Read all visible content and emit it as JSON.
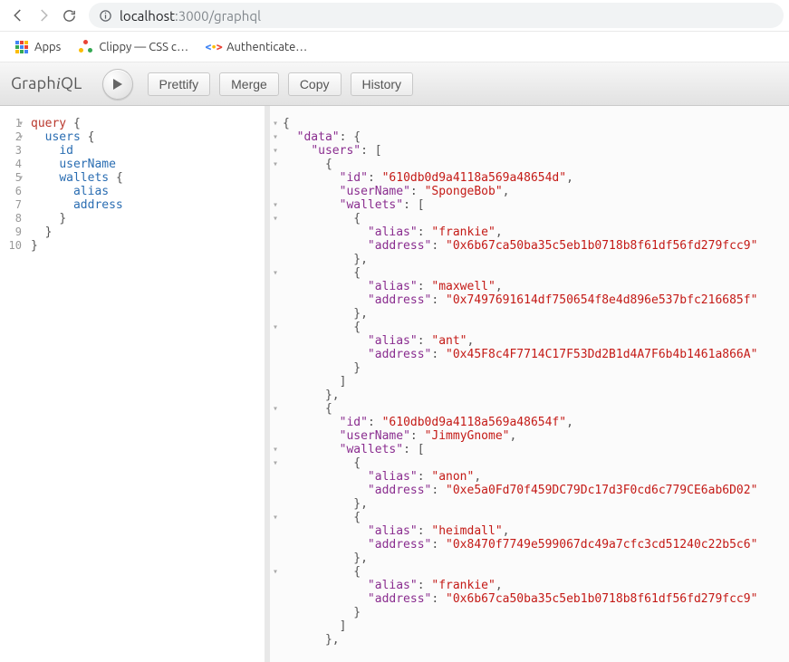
{
  "browser": {
    "url_host": "localhost",
    "url_port_path": ":3000/graphql"
  },
  "bookmarks": {
    "apps": "Apps",
    "clippy": "Clippy — CSS c…",
    "authenticate": "Authenticate…"
  },
  "toolbar": {
    "logo_graph": "Graph",
    "logo_i": "i",
    "logo_ql": "QL",
    "prettify": "Prettify",
    "merge": "Merge",
    "copy": "Copy",
    "history": "History"
  },
  "query": {
    "lines": [
      "1",
      "2",
      "3",
      "4",
      "5",
      "6",
      "7",
      "8",
      "9",
      "10"
    ],
    "text": "query {\n  users {\n    id\n    userName\n    wallets {\n      alias\n      address\n    }\n  }\n}"
  },
  "result": {
    "data": {
      "users": [
        {
          "id": "610db0d9a4118a569a48654d",
          "userName": "SpongeBob",
          "wallets": [
            {
              "alias": "frankie",
              "address": "0x6b67ca50ba35c5eb1b0718b8f61df56fd279fcc9"
            },
            {
              "alias": "maxwell",
              "address": "0x7497691614df750654f8e4d896e537bfc216685f"
            },
            {
              "alias": "ant",
              "address": "0x45F8c4F7714C17F53Dd2B1d4A7F6b4b1461a866A"
            }
          ]
        },
        {
          "id": "610db0d9a4118a569a48654f",
          "userName": "JimmyGnome",
          "wallets": [
            {
              "alias": "anon",
              "address": "0xe5a0Fd70f459DC79Dc17d3F0cd6c779CE6ab6D02"
            },
            {
              "alias": "heimdall",
              "address": "0x8470f7749e599067dc49a7cfc3cd51240c22b5c6"
            },
            {
              "alias": "frankie",
              "address": "0x6b67ca50ba35c5eb1b0718b8f61df56fd279fcc9"
            }
          ]
        }
      ]
    }
  }
}
